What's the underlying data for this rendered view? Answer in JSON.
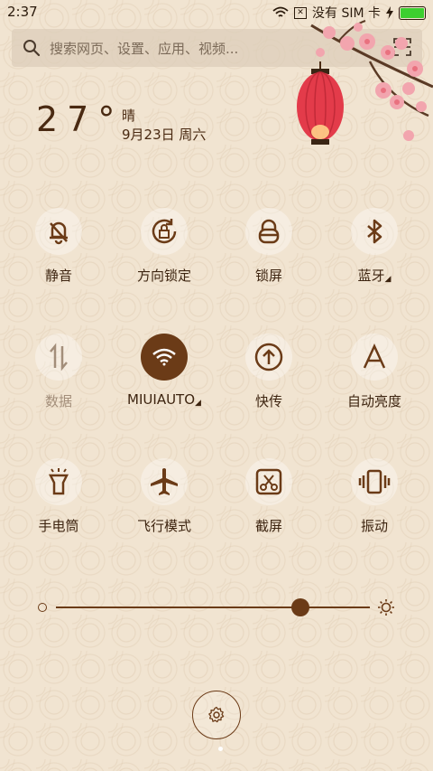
{
  "status_bar": {
    "time": "2:37",
    "carrier": "没有 SIM 卡",
    "battery_level": 1.0
  },
  "search": {
    "placeholder": "搜索网页、设置、应用、视频..."
  },
  "weather": {
    "temperature": "27°",
    "condition": "晴",
    "date": "9月23日 周六"
  },
  "tiles": [
    {
      "label": "静音",
      "icon": "bell-mute-icon"
    },
    {
      "label": "方向锁定",
      "icon": "rotation-lock-icon"
    },
    {
      "label": "锁屏",
      "icon": "lock-icon"
    },
    {
      "label": "蓝牙",
      "icon": "bluetooth-icon"
    },
    {
      "label": "数据",
      "icon": "data-icon"
    },
    {
      "label": "MIUIAUTO",
      "icon": "wifi-icon"
    },
    {
      "label": "快传",
      "icon": "upload-icon"
    },
    {
      "label": "自动亮度",
      "icon": "auto-brightness-icon"
    },
    {
      "label": "手电筒",
      "icon": "flashlight-icon"
    },
    {
      "label": "飞行模式",
      "icon": "airplane-icon"
    },
    {
      "label": "截屏",
      "icon": "screenshot-icon"
    },
    {
      "label": "振动",
      "icon": "vibrate-icon"
    }
  ],
  "brightness": {
    "level": 0.78
  },
  "colors": {
    "accent": "#6b3b17",
    "background": "#f1e4d1",
    "battery": "#3ccf2f"
  }
}
